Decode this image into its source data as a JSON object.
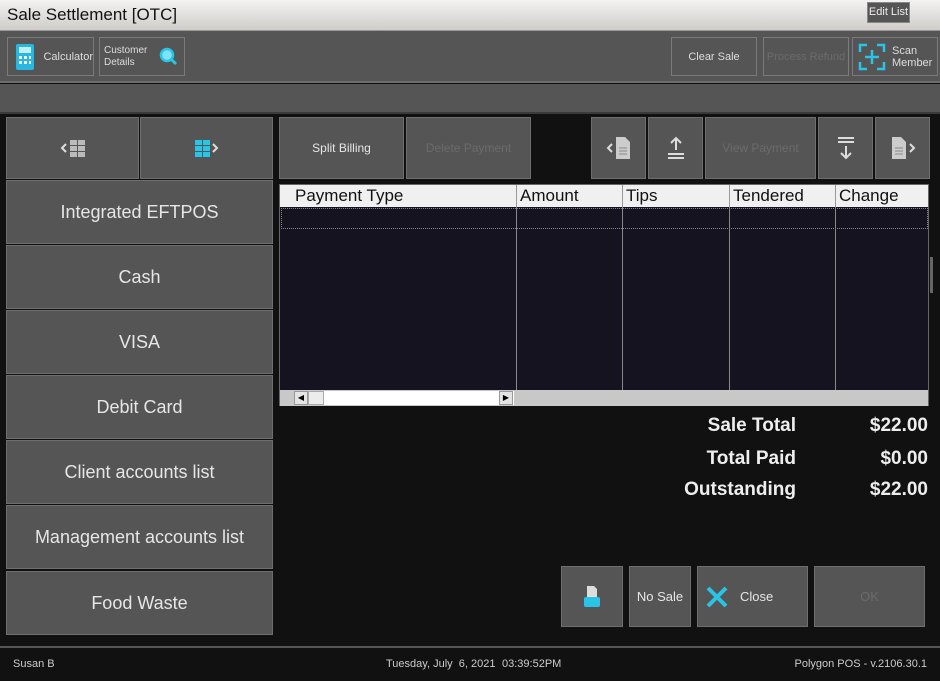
{
  "window": {
    "title": "Sale Settlement [OTC]",
    "edit_list": "Edit List"
  },
  "toolbar": {
    "calculator": "Calculator",
    "customer_details_line1": "Customer",
    "customer_details_line2": "Details",
    "clear_sale": "Clear Sale",
    "process_refund": "Process Refund",
    "scan_member_line1": "Scan",
    "scan_member_line2": "Member"
  },
  "payment_types": [
    "Integrated EFTPOS",
    "Cash",
    "VISA",
    "Debit Card",
    "Client accounts list",
    "Management accounts list",
    "Food Waste"
  ],
  "actions": {
    "split_billing": "Split Billing",
    "delete_payment": "Delete Payment",
    "view_payment": "View Payment"
  },
  "grid": {
    "columns": [
      "Payment Type",
      "Amount",
      "Tips",
      "Tendered",
      "Change"
    ],
    "rows": []
  },
  "totals": {
    "sale_total_label": "Sale Total",
    "sale_total": "$22.00",
    "total_paid_label": "Total Paid",
    "total_paid": "$0.00",
    "outstanding_label": "Outstanding",
    "outstanding": "$22.00"
  },
  "bottom": {
    "no_sale": "No Sale",
    "close": "Close",
    "ok": "OK"
  },
  "status": {
    "user": "Susan B",
    "date": "Tuesday, July  6, 2021",
    "time": "03:39:52PM",
    "version": "Polygon POS - v.2106.30.1"
  },
  "colors": {
    "accent": "#29c4e6"
  }
}
